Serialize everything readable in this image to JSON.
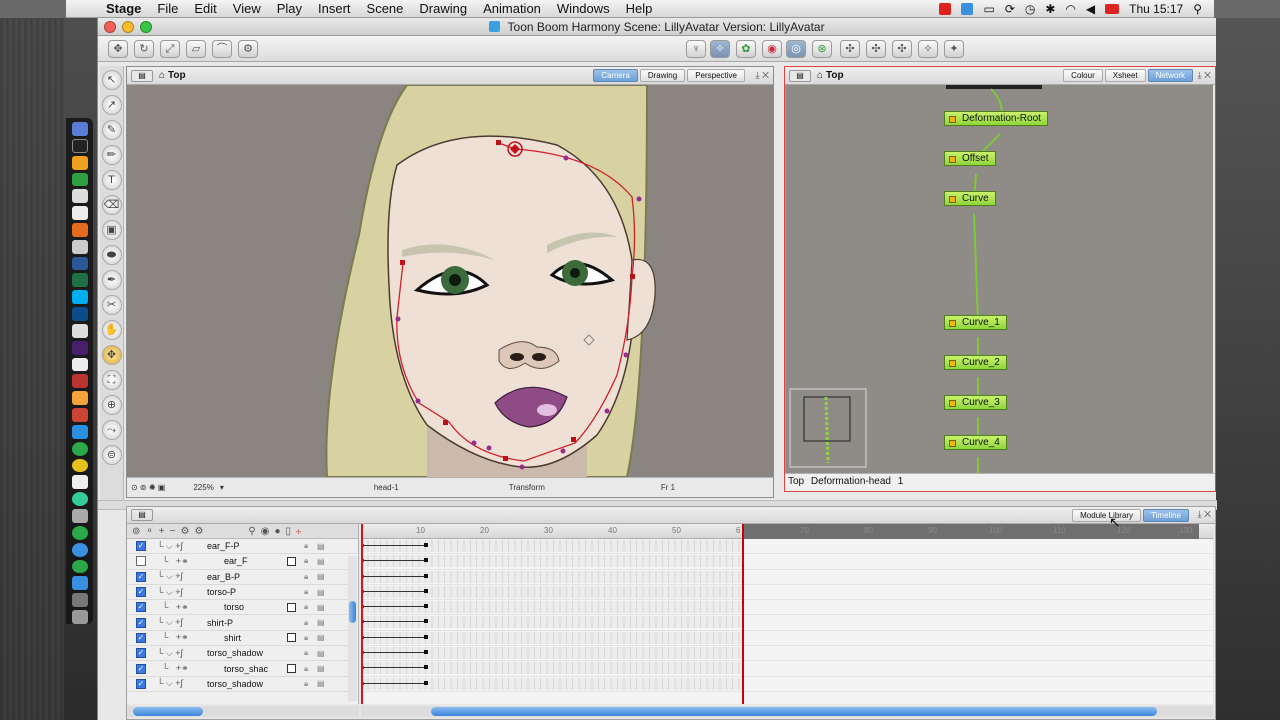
{
  "menubar": {
    "apple": "",
    "items": [
      "Stage",
      "File",
      "Edit",
      "View",
      "Play",
      "Insert",
      "Scene",
      "Drawing",
      "Animation",
      "Windows",
      "Help"
    ],
    "clock": "Thu 15:17"
  },
  "window": {
    "title": "Toon Boom Harmony Scene: LillyAvatar Version: LillyAvatar"
  },
  "camera_view": {
    "title": "Top",
    "tabs": [
      "Camera",
      "Drawing",
      "Perspective"
    ],
    "active_tab": "Camera",
    "zoom": "225%",
    "drawing": "head-1",
    "mode": "Transform",
    "frame": "Fr 1"
  },
  "network_view": {
    "title": "Top",
    "tabs": [
      "Colour",
      "Xsheet",
      "Network"
    ],
    "active_tab": "Network",
    "nodes": [
      "Deformation-Root",
      "Offset",
      "Curve",
      "Curve_1",
      "Curve_2",
      "Curve_3",
      "Curve_4"
    ],
    "status_parent": "Top",
    "status_node": "Deformation-head",
    "status_num": "1"
  },
  "timeline": {
    "tabs": [
      "Module Library",
      "Timeline"
    ],
    "active_tab": "Timeline",
    "ruler": [
      "10",
      "20",
      "30",
      "40",
      "50",
      "6",
      "70",
      "80",
      "90",
      "100",
      "110",
      "120",
      "130"
    ],
    "layers": [
      {
        "name": "ear_F-P",
        "checked": true,
        "deep": false
      },
      {
        "name": "ear_F",
        "checked": false,
        "deep": true
      },
      {
        "name": "ear_B-P",
        "checked": true,
        "deep": false
      },
      {
        "name": "torso-P",
        "checked": true,
        "deep": false
      },
      {
        "name": "torso",
        "checked": true,
        "deep": true
      },
      {
        "name": "shirt-P",
        "checked": true,
        "deep": false
      },
      {
        "name": "shirt",
        "checked": true,
        "deep": true
      },
      {
        "name": "torso_shadow",
        "checked": true,
        "deep": false
      },
      {
        "name": "torso_shac",
        "checked": true,
        "deep": true
      },
      {
        "name": "torso_shadow",
        "checked": true,
        "deep": false
      }
    ]
  }
}
